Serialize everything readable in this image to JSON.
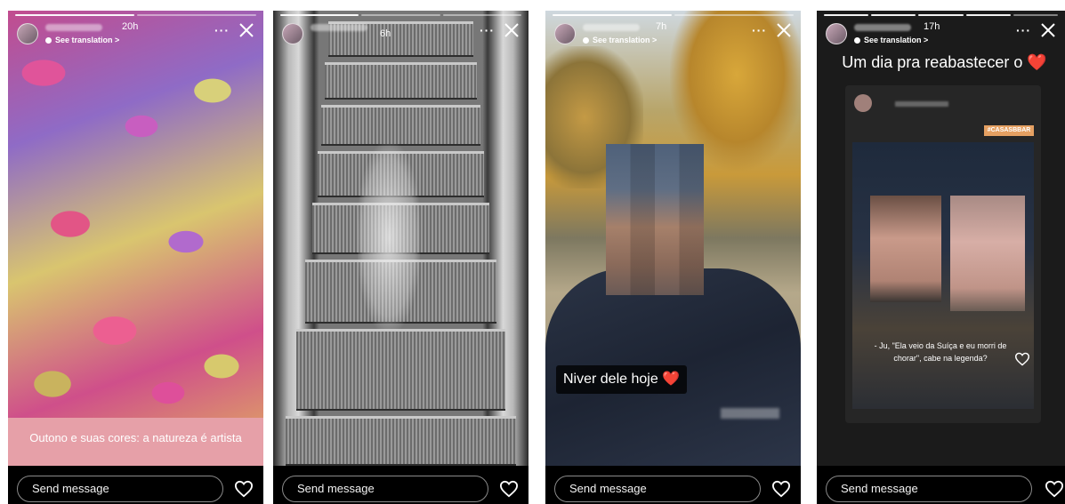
{
  "common": {
    "see_translation": "See translation >",
    "send_message_placeholder": "Send message",
    "more_label": "···"
  },
  "stories": [
    {
      "time": "20h",
      "caption": "Outono  e suas cores: a natureza é artista",
      "colors": {
        "caption_band": "#e6a0a8"
      }
    },
    {
      "time": "6h"
    },
    {
      "time": "7h",
      "caption": "Niver dele hoje ❤️"
    },
    {
      "time": "17h",
      "title": "Um dia pra  reabastecer o ❤️",
      "tag": "#CASASBBAR",
      "quote": "- Ju, \"Ela veio da Suíça e eu morri de chorar\", cabe na legenda?"
    }
  ]
}
